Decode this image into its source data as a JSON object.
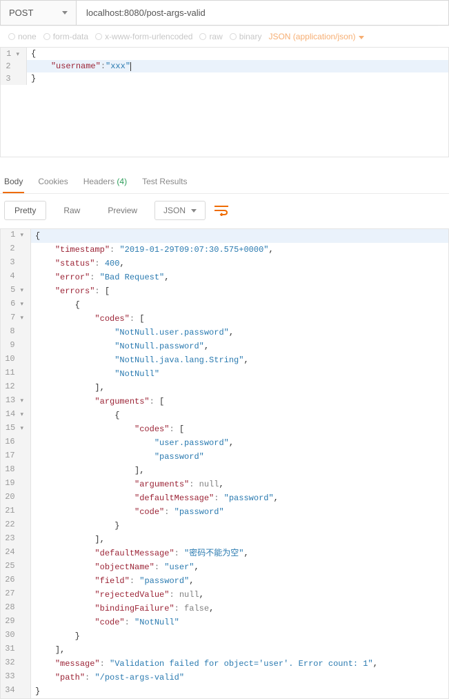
{
  "request": {
    "method": "POST",
    "url": "localhost:8080/post-args-valid",
    "body_types": {
      "none": "none",
      "form": "form-data",
      "urlencoded": "x-www-form-urlencoded",
      "raw": "raw",
      "binary": "binary",
      "selected_content_type": "JSON (application/json)"
    },
    "editor": {
      "line1_open": "{",
      "line2_key": "\"username\"",
      "line2_value": "\"xxx\"",
      "line3_close": "}"
    }
  },
  "response": {
    "tabs": {
      "body": "Body",
      "cookies": "Cookies",
      "headers": "Headers",
      "headers_count": "(4)",
      "test_results": "Test Results"
    },
    "formats": {
      "pretty": "Pretty",
      "raw": "Raw",
      "preview": "Preview",
      "type": "JSON"
    },
    "body_lines": [
      {
        "n": 1,
        "fold": true,
        "indent": 0,
        "toks": [
          [
            "brace",
            "{"
          ]
        ]
      },
      {
        "n": 2,
        "fold": false,
        "indent": 1,
        "toks": [
          [
            "key",
            "\"timestamp\""
          ],
          [
            "colon",
            ": "
          ],
          [
            "str",
            "\"2019-01-29T09:07:30.575+0000\""
          ],
          [
            "brace",
            ","
          ]
        ]
      },
      {
        "n": 3,
        "fold": false,
        "indent": 1,
        "toks": [
          [
            "key",
            "\"status\""
          ],
          [
            "colon",
            ": "
          ],
          [
            "num",
            "400"
          ],
          [
            "brace",
            ","
          ]
        ]
      },
      {
        "n": 4,
        "fold": false,
        "indent": 1,
        "toks": [
          [
            "key",
            "\"error\""
          ],
          [
            "colon",
            ": "
          ],
          [
            "str",
            "\"Bad Request\""
          ],
          [
            "brace",
            ","
          ]
        ]
      },
      {
        "n": 5,
        "fold": true,
        "indent": 1,
        "toks": [
          [
            "key",
            "\"errors\""
          ],
          [
            "colon",
            ": "
          ],
          [
            "brace",
            "["
          ]
        ]
      },
      {
        "n": 6,
        "fold": true,
        "indent": 2,
        "toks": [
          [
            "brace",
            "{"
          ]
        ]
      },
      {
        "n": 7,
        "fold": true,
        "indent": 3,
        "toks": [
          [
            "key",
            "\"codes\""
          ],
          [
            "colon",
            ": "
          ],
          [
            "brace",
            "["
          ]
        ]
      },
      {
        "n": 8,
        "fold": false,
        "indent": 4,
        "toks": [
          [
            "str",
            "\"NotNull.user.password\""
          ],
          [
            "brace",
            ","
          ]
        ]
      },
      {
        "n": 9,
        "fold": false,
        "indent": 4,
        "toks": [
          [
            "str",
            "\"NotNull.password\""
          ],
          [
            "brace",
            ","
          ]
        ]
      },
      {
        "n": 10,
        "fold": false,
        "indent": 4,
        "toks": [
          [
            "str",
            "\"NotNull.java.lang.String\""
          ],
          [
            "brace",
            ","
          ]
        ]
      },
      {
        "n": 11,
        "fold": false,
        "indent": 4,
        "toks": [
          [
            "str",
            "\"NotNull\""
          ]
        ]
      },
      {
        "n": 12,
        "fold": false,
        "indent": 3,
        "toks": [
          [
            "brace",
            "],"
          ]
        ]
      },
      {
        "n": 13,
        "fold": true,
        "indent": 3,
        "toks": [
          [
            "key",
            "\"arguments\""
          ],
          [
            "colon",
            ": "
          ],
          [
            "brace",
            "["
          ]
        ]
      },
      {
        "n": 14,
        "fold": true,
        "indent": 4,
        "toks": [
          [
            "brace",
            "{"
          ]
        ]
      },
      {
        "n": 15,
        "fold": true,
        "indent": 5,
        "toks": [
          [
            "key",
            "\"codes\""
          ],
          [
            "colon",
            ": "
          ],
          [
            "brace",
            "["
          ]
        ]
      },
      {
        "n": 16,
        "fold": false,
        "indent": 6,
        "toks": [
          [
            "str",
            "\"user.password\""
          ],
          [
            "brace",
            ","
          ]
        ]
      },
      {
        "n": 17,
        "fold": false,
        "indent": 6,
        "toks": [
          [
            "str",
            "\"password\""
          ]
        ]
      },
      {
        "n": 18,
        "fold": false,
        "indent": 5,
        "toks": [
          [
            "brace",
            "],"
          ]
        ]
      },
      {
        "n": 19,
        "fold": false,
        "indent": 5,
        "toks": [
          [
            "key",
            "\"arguments\""
          ],
          [
            "colon",
            ": "
          ],
          [
            "null",
            "null"
          ],
          [
            "brace",
            ","
          ]
        ]
      },
      {
        "n": 20,
        "fold": false,
        "indent": 5,
        "toks": [
          [
            "key",
            "\"defaultMessage\""
          ],
          [
            "colon",
            ": "
          ],
          [
            "str",
            "\"password\""
          ],
          [
            "brace",
            ","
          ]
        ]
      },
      {
        "n": 21,
        "fold": false,
        "indent": 5,
        "toks": [
          [
            "key",
            "\"code\""
          ],
          [
            "colon",
            ": "
          ],
          [
            "str",
            "\"password\""
          ]
        ]
      },
      {
        "n": 22,
        "fold": false,
        "indent": 4,
        "toks": [
          [
            "brace",
            "}"
          ]
        ]
      },
      {
        "n": 23,
        "fold": false,
        "indent": 3,
        "toks": [
          [
            "brace",
            "],"
          ]
        ]
      },
      {
        "n": 24,
        "fold": false,
        "indent": 3,
        "toks": [
          [
            "key",
            "\"defaultMessage\""
          ],
          [
            "colon",
            ": "
          ],
          [
            "str",
            "\"密码不能为空\""
          ],
          [
            "brace",
            ","
          ]
        ]
      },
      {
        "n": 25,
        "fold": false,
        "indent": 3,
        "toks": [
          [
            "key",
            "\"objectName\""
          ],
          [
            "colon",
            ": "
          ],
          [
            "str",
            "\"user\""
          ],
          [
            "brace",
            ","
          ]
        ]
      },
      {
        "n": 26,
        "fold": false,
        "indent": 3,
        "toks": [
          [
            "key",
            "\"field\""
          ],
          [
            "colon",
            ": "
          ],
          [
            "str",
            "\"password\""
          ],
          [
            "brace",
            ","
          ]
        ]
      },
      {
        "n": 27,
        "fold": false,
        "indent": 3,
        "toks": [
          [
            "key",
            "\"rejectedValue\""
          ],
          [
            "colon",
            ": "
          ],
          [
            "null",
            "null"
          ],
          [
            "brace",
            ","
          ]
        ]
      },
      {
        "n": 28,
        "fold": false,
        "indent": 3,
        "toks": [
          [
            "key",
            "\"bindingFailure\""
          ],
          [
            "colon",
            ": "
          ],
          [
            "null",
            "false"
          ],
          [
            "brace",
            ","
          ]
        ]
      },
      {
        "n": 29,
        "fold": false,
        "indent": 3,
        "toks": [
          [
            "key",
            "\"code\""
          ],
          [
            "colon",
            ": "
          ],
          [
            "str",
            "\"NotNull\""
          ]
        ]
      },
      {
        "n": 30,
        "fold": false,
        "indent": 2,
        "toks": [
          [
            "brace",
            "}"
          ]
        ]
      },
      {
        "n": 31,
        "fold": false,
        "indent": 1,
        "toks": [
          [
            "brace",
            "],"
          ]
        ]
      },
      {
        "n": 32,
        "fold": false,
        "indent": 1,
        "toks": [
          [
            "key",
            "\"message\""
          ],
          [
            "colon",
            ": "
          ],
          [
            "str",
            "\"Validation failed for object='user'. Error count: 1\""
          ],
          [
            "brace",
            ","
          ]
        ]
      },
      {
        "n": 33,
        "fold": false,
        "indent": 1,
        "toks": [
          [
            "key",
            "\"path\""
          ],
          [
            "colon",
            ": "
          ],
          [
            "str",
            "\"/post-args-valid\""
          ]
        ]
      },
      {
        "n": 34,
        "fold": false,
        "indent": 0,
        "toks": [
          [
            "brace",
            "}"
          ]
        ]
      }
    ]
  }
}
